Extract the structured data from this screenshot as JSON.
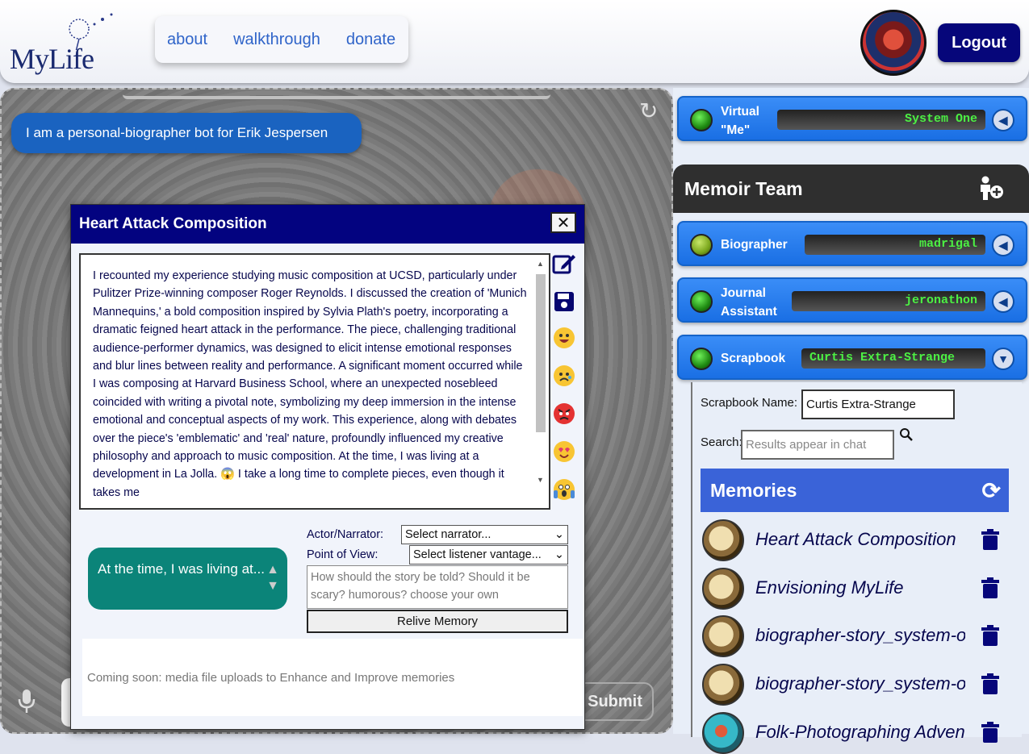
{
  "header": {
    "logo_text": "MyLife",
    "nav": [
      "about",
      "walkthrough",
      "donate"
    ],
    "logout_label": "Logout"
  },
  "chat": {
    "intro_message": "I am a personal-biographer bot for Erik Jespersen",
    "submit_label": "Submit"
  },
  "memory_modal": {
    "title": "Heart Attack Composition",
    "close_label": "✕",
    "summary": "I recounted my experience studying music composition at UCSD, particularly under Pulitzer Prize-winning composer Roger Reynolds. I discussed the creation of 'Munich Mannequins,' a bold composition inspired by Sylvia Plath's poetry, incorporating a dramatic feigned heart attack in the performance. The piece, challenging traditional audience-performer dynamics, was designed to elicit intense emotional responses and blur lines between reality and performance. A significant moment occurred while I was composing at Harvard Business School, where an unexpected nosebleed coincided with writing a pivotal note, symbolizing my deep immersion in the intense emotional and conceptual aspects of my work. This experience, along with debates over the piece's 'emblematic' and 'real' nature, profoundly influenced my creative philosophy and approach to music composition. At the time, I was living at a development in La Jolla. 😱 I take a long time to complete pieces, even though it takes me",
    "relive_bubble": "At the time, I was living at...",
    "actor_label": "Actor/Narrator:",
    "actor_select": "Select narrator...",
    "pov_label": "Point of View:",
    "pov_select": "Select listener vantage...",
    "story_placeholder": "How should the story be told? Should it be scary? humorous? choose your own",
    "relive_button": "Relive Memory",
    "media_note": "Coming soon: media file uploads to Enhance and Improve memories"
  },
  "sidebar": {
    "virtual_me": {
      "label": "Virtual \"Me\"",
      "value": "System One"
    },
    "team_title": "Memoir Team",
    "bots": [
      {
        "label": "Biographer",
        "value": "madrigal"
      },
      {
        "label": "Journal Assistant",
        "value": "jeronathon"
      },
      {
        "label": "Scrapbook",
        "value": "Curtis Extra-Strange"
      }
    ],
    "scrapbook": {
      "name_label": "Scrapbook Name:",
      "name_value": "Curtis Extra-Strange",
      "search_label": "Search:",
      "search_placeholder": "Results appear in chat",
      "memories_title": "Memories",
      "memories": [
        "Heart Attack Composition",
        "Envisioning MyLife",
        "biographer-story_system-one",
        "biographer-story_system-one",
        "Folk-Photographing Adventure"
      ]
    }
  }
}
